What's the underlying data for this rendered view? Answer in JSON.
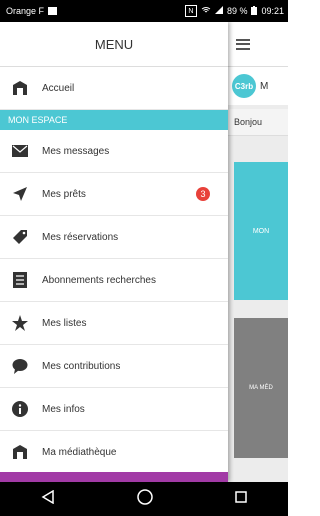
{
  "status": {
    "carrier": "Orange F",
    "battery": "89 %",
    "time": "09:21",
    "nfc": "N"
  },
  "drawer": {
    "title": "MENU",
    "home": "Accueil",
    "section": "MON ESPACE",
    "items": [
      {
        "label": "Mes messages",
        "icon": "envelope-icon"
      },
      {
        "label": "Mes prêts",
        "icon": "send-icon",
        "badge": "3"
      },
      {
        "label": "Mes réservations",
        "icon": "tag-icon"
      },
      {
        "label": "Abonnements recherches",
        "icon": "list-icon"
      },
      {
        "label": "Mes listes",
        "icon": "star-icon"
      },
      {
        "label": "Mes contributions",
        "icon": "chat-bubble-icon"
      },
      {
        "label": "Mes infos",
        "icon": "info-icon"
      },
      {
        "label": "Ma médiathèque",
        "icon": "library-icon"
      }
    ]
  },
  "main": {
    "logo": "C3rb",
    "logo_text": "M",
    "greeting": "Bonjou",
    "tile1": "MON",
    "tile2": "MA MÉD"
  },
  "colors": {
    "accent": "#4cc7d3",
    "badge": "#e8413a",
    "purple": "#a23aa6"
  }
}
